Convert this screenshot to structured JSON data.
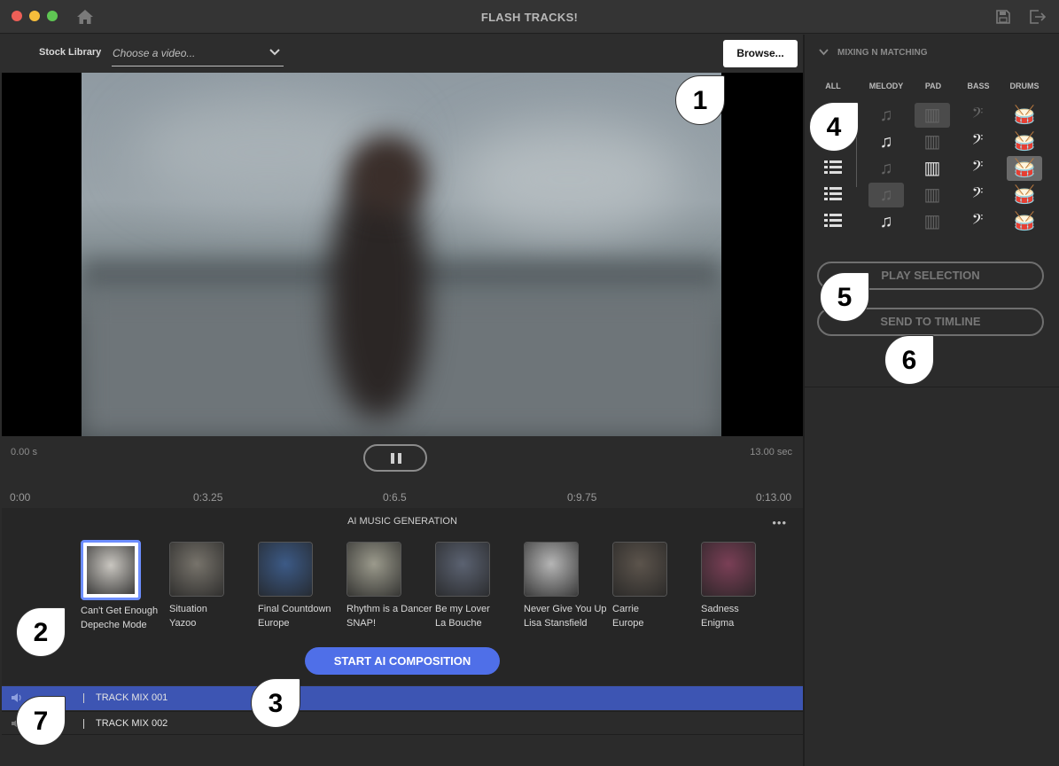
{
  "window": {
    "title": "FLASH TRACKS!"
  },
  "stock": {
    "label": "Stock Library",
    "select_value": "Choose a video...",
    "browse_label": "Browse..."
  },
  "player": {
    "time_start": "0.00 s",
    "time_end": "13.00 sec",
    "state": "playing"
  },
  "timeline": {
    "ticks": [
      "0:00",
      "0:3.25",
      "0:6.5",
      "0:9.75",
      "0:13.00"
    ]
  },
  "ai": {
    "title": "AI MUSIC GENERATION",
    "more_label": "•••",
    "albums": [
      {
        "title": "Can't Get Enough",
        "artist": "Depeche Mode",
        "selected": true,
        "color": "#c9c6c0"
      },
      {
        "title": "Situation",
        "artist": "Yazoo",
        "selected": false,
        "color": "#77736b"
      },
      {
        "title": "Final Countdown",
        "artist": "Europe",
        "selected": false,
        "color": "#3c5a86"
      },
      {
        "title": "Rhythm is a Dancer",
        "artist": "SNAP!",
        "selected": false,
        "color": "#9b9a8c"
      },
      {
        "title": "Be my Lover",
        "artist": "La Bouche",
        "selected": false,
        "color": "#5b6271"
      },
      {
        "title": "Never Give You Up",
        "artist": "Lisa Stansfield",
        "selected": false,
        "color": "#b5b5b5"
      },
      {
        "title": "Carrie",
        "artist": "Europe",
        "selected": false,
        "color": "#5c544c"
      },
      {
        "title": "Sadness",
        "artist": "Enigma",
        "selected": false,
        "color": "#7a3f56"
      }
    ],
    "start_label": "START AI COMPOSITION"
  },
  "tracks": [
    {
      "name": "TRACK MIX 001",
      "selected": true
    },
    {
      "name": "TRACK MIX 002",
      "selected": false
    }
  ],
  "mixing": {
    "title": "MIXING N MATCHING",
    "columns": [
      "ALL",
      "MELODY",
      "PAD",
      "BASS",
      "DRUMS"
    ],
    "play_label": "PLAY SELECTION",
    "send_label": "SEND TO TIMLINE"
  },
  "callouts": [
    "1",
    "2",
    "3",
    "4",
    "5",
    "6",
    "7"
  ],
  "colors": {
    "accent": "#4f6fe8",
    "track_selected": "#3d55b3",
    "background": "#2b2b2b"
  }
}
